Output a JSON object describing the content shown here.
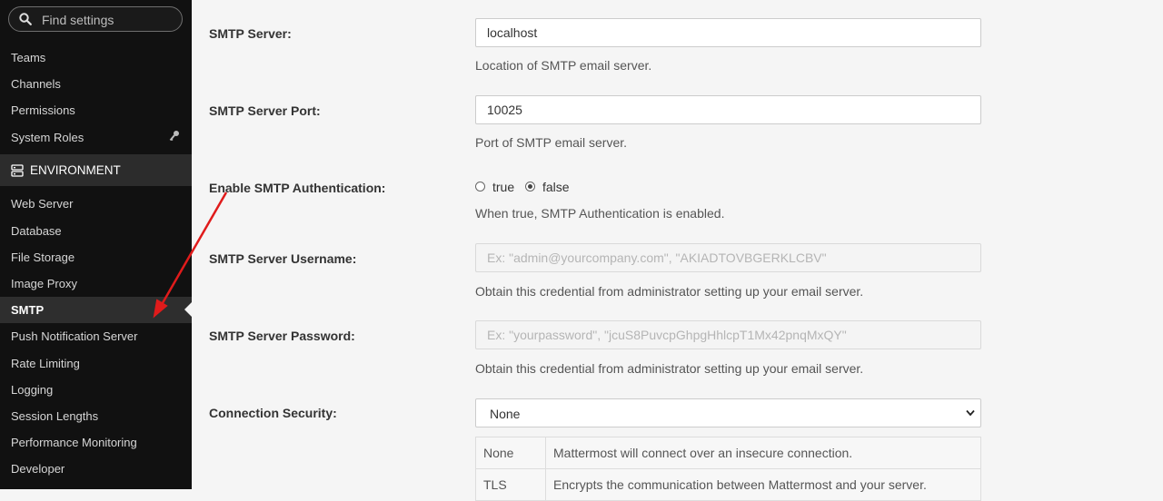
{
  "sidebar": {
    "search_placeholder": "Find settings",
    "items_top": [
      {
        "label": "Teams"
      },
      {
        "label": "Channels"
      },
      {
        "label": "Permissions"
      },
      {
        "label": "System Roles"
      }
    ],
    "section_label": "ENVIRONMENT",
    "items": [
      {
        "label": "Web Server"
      },
      {
        "label": "Database"
      },
      {
        "label": "File Storage"
      },
      {
        "label": "Image Proxy"
      },
      {
        "label": "SMTP"
      },
      {
        "label": "Push Notification Server"
      },
      {
        "label": "Rate Limiting"
      },
      {
        "label": "Logging"
      },
      {
        "label": "Session Lengths"
      },
      {
        "label": "Performance Monitoring"
      },
      {
        "label": "Developer"
      }
    ],
    "active_item": "SMTP"
  },
  "form": {
    "smtp_server": {
      "label": "SMTP Server:",
      "value": "localhost",
      "help": "Location of SMTP email server."
    },
    "smtp_port": {
      "label": "SMTP Server Port:",
      "value": "10025",
      "help": "Port of SMTP email server."
    },
    "smtp_auth": {
      "label": "Enable SMTP Authentication:",
      "option_true": "true",
      "option_false": "false",
      "selected": "false",
      "help": "When true, SMTP Authentication is enabled."
    },
    "smtp_username": {
      "label": "SMTP Server Username:",
      "placeholder": "Ex: \"admin@yourcompany.com\", \"AKIADTOVBGERKLCBV\"",
      "help": "Obtain this credential from administrator setting up your email server."
    },
    "smtp_password": {
      "label": "SMTP Server Password:",
      "placeholder": "Ex: \"yourpassword\", \"jcuS8PuvcpGhpgHhlcpT1Mx42pnqMxQY\"",
      "help": "Obtain this credential from administrator setting up your email server."
    },
    "connection_security": {
      "label": "Connection Security:",
      "value": "None",
      "options": [
        {
          "name": "None",
          "desc": "Mattermost will connect over an insecure connection."
        },
        {
          "name": "TLS",
          "desc": "Encrypts the communication between Mattermost and your server."
        }
      ]
    }
  },
  "colors": {
    "sidebar_bg": "#111111",
    "annotation_arrow": "#e01b1b"
  }
}
